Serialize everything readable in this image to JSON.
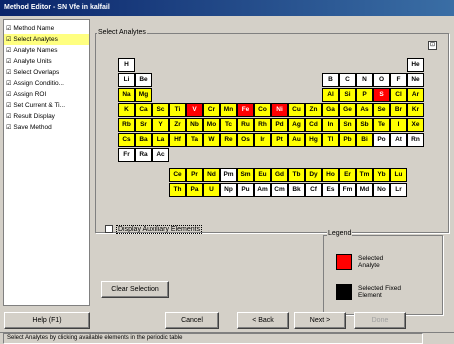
{
  "window": {
    "title": "Method Editor - SN Vfe in kalfail"
  },
  "sidebar": {
    "items": [
      {
        "label": "Method Name",
        "active": false
      },
      {
        "label": "Select Analytes",
        "active": true
      },
      {
        "label": "Analyte Names",
        "active": false
      },
      {
        "label": "Analyte Units",
        "active": false
      },
      {
        "label": "Select Overlaps",
        "active": false
      },
      {
        "label": "Assign Conditio...",
        "active": false
      },
      {
        "label": "Assign ROI",
        "active": false
      },
      {
        "label": "Set Current & Ti...",
        "active": false
      },
      {
        "label": "Result Display",
        "active": false
      },
      {
        "label": "Save Method",
        "active": false
      }
    ]
  },
  "periodic": {
    "group_title": "Select Analytes",
    "collapse_label": "⊡",
    "elements": [
      {
        "sym": "H",
        "r": 0,
        "c": 0,
        "state": "unavail"
      },
      {
        "sym": "He",
        "r": 0,
        "c": 17,
        "state": "unavail"
      },
      {
        "sym": "Li",
        "r": 1,
        "c": 0,
        "state": "unavail"
      },
      {
        "sym": "Be",
        "r": 1,
        "c": 1,
        "state": "unavail"
      },
      {
        "sym": "B",
        "r": 1,
        "c": 12,
        "state": "unavail"
      },
      {
        "sym": "C",
        "r": 1,
        "c": 13,
        "state": "unavail"
      },
      {
        "sym": "N",
        "r": 1,
        "c": 14,
        "state": "unavail"
      },
      {
        "sym": "O",
        "r": 1,
        "c": 15,
        "state": "unavail"
      },
      {
        "sym": "F",
        "r": 1,
        "c": 16,
        "state": "unavail"
      },
      {
        "sym": "Ne",
        "r": 1,
        "c": 17,
        "state": "unavail"
      },
      {
        "sym": "Na",
        "r": 2,
        "c": 0,
        "state": "avail"
      },
      {
        "sym": "Mg",
        "r": 2,
        "c": 1,
        "state": "avail"
      },
      {
        "sym": "Al",
        "r": 2,
        "c": 12,
        "state": "avail"
      },
      {
        "sym": "Si",
        "r": 2,
        "c": 13,
        "state": "avail"
      },
      {
        "sym": "P",
        "r": 2,
        "c": 14,
        "state": "avail"
      },
      {
        "sym": "S",
        "r": 2,
        "c": 15,
        "state": "sel"
      },
      {
        "sym": "Cl",
        "r": 2,
        "c": 16,
        "state": "avail"
      },
      {
        "sym": "Ar",
        "r": 2,
        "c": 17,
        "state": "avail"
      },
      {
        "sym": "K",
        "r": 3,
        "c": 0,
        "state": "avail"
      },
      {
        "sym": "Ca",
        "r": 3,
        "c": 1,
        "state": "avail"
      },
      {
        "sym": "Sc",
        "r": 3,
        "c": 2,
        "state": "avail"
      },
      {
        "sym": "Ti",
        "r": 3,
        "c": 3,
        "state": "avail"
      },
      {
        "sym": "V",
        "r": 3,
        "c": 4,
        "state": "sel"
      },
      {
        "sym": "Cr",
        "r": 3,
        "c": 5,
        "state": "avail"
      },
      {
        "sym": "Mn",
        "r": 3,
        "c": 6,
        "state": "avail"
      },
      {
        "sym": "Fe",
        "r": 3,
        "c": 7,
        "state": "sel"
      },
      {
        "sym": "Co",
        "r": 3,
        "c": 8,
        "state": "avail"
      },
      {
        "sym": "Ni",
        "r": 3,
        "c": 9,
        "state": "sel"
      },
      {
        "sym": "Cu",
        "r": 3,
        "c": 10,
        "state": "avail"
      },
      {
        "sym": "Zn",
        "r": 3,
        "c": 11,
        "state": "avail"
      },
      {
        "sym": "Ga",
        "r": 3,
        "c": 12,
        "state": "avail"
      },
      {
        "sym": "Ge",
        "r": 3,
        "c": 13,
        "state": "avail"
      },
      {
        "sym": "As",
        "r": 3,
        "c": 14,
        "state": "avail"
      },
      {
        "sym": "Se",
        "r": 3,
        "c": 15,
        "state": "avail"
      },
      {
        "sym": "Br",
        "r": 3,
        "c": 16,
        "state": "avail"
      },
      {
        "sym": "Kr",
        "r": 3,
        "c": 17,
        "state": "avail"
      },
      {
        "sym": "Rb",
        "r": 4,
        "c": 0,
        "state": "avail"
      },
      {
        "sym": "Sr",
        "r": 4,
        "c": 1,
        "state": "avail"
      },
      {
        "sym": "Y",
        "r": 4,
        "c": 2,
        "state": "avail"
      },
      {
        "sym": "Zr",
        "r": 4,
        "c": 3,
        "state": "avail"
      },
      {
        "sym": "Nb",
        "r": 4,
        "c": 4,
        "state": "avail"
      },
      {
        "sym": "Mo",
        "r": 4,
        "c": 5,
        "state": "avail"
      },
      {
        "sym": "Tc",
        "r": 4,
        "c": 6,
        "state": "avail"
      },
      {
        "sym": "Ru",
        "r": 4,
        "c": 7,
        "state": "avail"
      },
      {
        "sym": "Rh",
        "r": 4,
        "c": 8,
        "state": "avail"
      },
      {
        "sym": "Pd",
        "r": 4,
        "c": 9,
        "state": "avail"
      },
      {
        "sym": "Ag",
        "r": 4,
        "c": 10,
        "state": "avail"
      },
      {
        "sym": "Cd",
        "r": 4,
        "c": 11,
        "state": "avail"
      },
      {
        "sym": "In",
        "r": 4,
        "c": 12,
        "state": "avail"
      },
      {
        "sym": "Sn",
        "r": 4,
        "c": 13,
        "state": "avail"
      },
      {
        "sym": "Sb",
        "r": 4,
        "c": 14,
        "state": "avail"
      },
      {
        "sym": "Te",
        "r": 4,
        "c": 15,
        "state": "avail"
      },
      {
        "sym": "I",
        "r": 4,
        "c": 16,
        "state": "avail"
      },
      {
        "sym": "Xe",
        "r": 4,
        "c": 17,
        "state": "avail"
      },
      {
        "sym": "Cs",
        "r": 5,
        "c": 0,
        "state": "avail"
      },
      {
        "sym": "Ba",
        "r": 5,
        "c": 1,
        "state": "avail"
      },
      {
        "sym": "La",
        "r": 5,
        "c": 2,
        "state": "avail"
      },
      {
        "sym": "Hf",
        "r": 5,
        "c": 3,
        "state": "avail"
      },
      {
        "sym": "Ta",
        "r": 5,
        "c": 4,
        "state": "avail"
      },
      {
        "sym": "W",
        "r": 5,
        "c": 5,
        "state": "avail"
      },
      {
        "sym": "Re",
        "r": 5,
        "c": 6,
        "state": "avail"
      },
      {
        "sym": "Os",
        "r": 5,
        "c": 7,
        "state": "avail"
      },
      {
        "sym": "Ir",
        "r": 5,
        "c": 8,
        "state": "avail"
      },
      {
        "sym": "Pt",
        "r": 5,
        "c": 9,
        "state": "avail"
      },
      {
        "sym": "Au",
        "r": 5,
        "c": 10,
        "state": "avail"
      },
      {
        "sym": "Hg",
        "r": 5,
        "c": 11,
        "state": "avail"
      },
      {
        "sym": "Tl",
        "r": 5,
        "c": 12,
        "state": "avail"
      },
      {
        "sym": "Pb",
        "r": 5,
        "c": 13,
        "state": "avail"
      },
      {
        "sym": "Bi",
        "r": 5,
        "c": 14,
        "state": "avail"
      },
      {
        "sym": "Po",
        "r": 5,
        "c": 15,
        "state": "unavail"
      },
      {
        "sym": "At",
        "r": 5,
        "c": 16,
        "state": "unavail"
      },
      {
        "sym": "Rn",
        "r": 5,
        "c": 17,
        "state": "unavail"
      },
      {
        "sym": "Fr",
        "r": 6,
        "c": 0,
        "state": "unavail"
      },
      {
        "sym": "Ra",
        "r": 6,
        "c": 1,
        "state": "unavail"
      },
      {
        "sym": "Ac",
        "r": 6,
        "c": 2,
        "state": "unavail"
      },
      {
        "sym": "Ce",
        "r": 7,
        "c": 3,
        "state": "avail"
      },
      {
        "sym": "Pr",
        "r": 7,
        "c": 4,
        "state": "avail"
      },
      {
        "sym": "Nd",
        "r": 7,
        "c": 5,
        "state": "avail"
      },
      {
        "sym": "Pm",
        "r": 7,
        "c": 6,
        "state": "unavail"
      },
      {
        "sym": "Sm",
        "r": 7,
        "c": 7,
        "state": "avail"
      },
      {
        "sym": "Eu",
        "r": 7,
        "c": 8,
        "state": "avail"
      },
      {
        "sym": "Gd",
        "r": 7,
        "c": 9,
        "state": "avail"
      },
      {
        "sym": "Tb",
        "r": 7,
        "c": 10,
        "state": "avail"
      },
      {
        "sym": "Dy",
        "r": 7,
        "c": 11,
        "state": "avail"
      },
      {
        "sym": "Ho",
        "r": 7,
        "c": 12,
        "state": "avail"
      },
      {
        "sym": "Er",
        "r": 7,
        "c": 13,
        "state": "avail"
      },
      {
        "sym": "Tm",
        "r": 7,
        "c": 14,
        "state": "avail"
      },
      {
        "sym": "Yb",
        "r": 7,
        "c": 15,
        "state": "avail"
      },
      {
        "sym": "Lu",
        "r": 7,
        "c": 16,
        "state": "avail"
      },
      {
        "sym": "Th",
        "r": 8,
        "c": 3,
        "state": "avail"
      },
      {
        "sym": "Pa",
        "r": 8,
        "c": 4,
        "state": "avail"
      },
      {
        "sym": "U",
        "r": 8,
        "c": 5,
        "state": "avail"
      },
      {
        "sym": "Np",
        "r": 8,
        "c": 6,
        "state": "unavail"
      },
      {
        "sym": "Pu",
        "r": 8,
        "c": 7,
        "state": "unavail"
      },
      {
        "sym": "Am",
        "r": 8,
        "c": 8,
        "state": "unavail"
      },
      {
        "sym": "Cm",
        "r": 8,
        "c": 9,
        "state": "unavail"
      },
      {
        "sym": "Bk",
        "r": 8,
        "c": 10,
        "state": "unavail"
      },
      {
        "sym": "Cf",
        "r": 8,
        "c": 11,
        "state": "unavail"
      },
      {
        "sym": "Es",
        "r": 8,
        "c": 12,
        "state": "unavail"
      },
      {
        "sym": "Fm",
        "r": 8,
        "c": 13,
        "state": "unavail"
      },
      {
        "sym": "Md",
        "r": 8,
        "c": 14,
        "state": "unavail"
      },
      {
        "sym": "No",
        "r": 8,
        "c": 15,
        "state": "unavail"
      },
      {
        "sym": "Lr",
        "r": 8,
        "c": 16,
        "state": "unavail"
      }
    ]
  },
  "aux": {
    "label": "Display Auxiliary Elements",
    "checked": false
  },
  "legend": {
    "title": "Legend",
    "selected_analyte": "Selected Analyte",
    "selected_fixed": "Selected Fixed Element",
    "colors": {
      "selected": "#ff0000",
      "fixed": "#000000",
      "available": "#ffff00"
    }
  },
  "buttons": {
    "clear": "Clear Selection",
    "help": "Help (F1)",
    "cancel": "Cancel",
    "back": "< Back",
    "next": "Next >",
    "done": "Done"
  },
  "status": {
    "text": "Select Analytes by clicking available elements in the periodic table"
  }
}
